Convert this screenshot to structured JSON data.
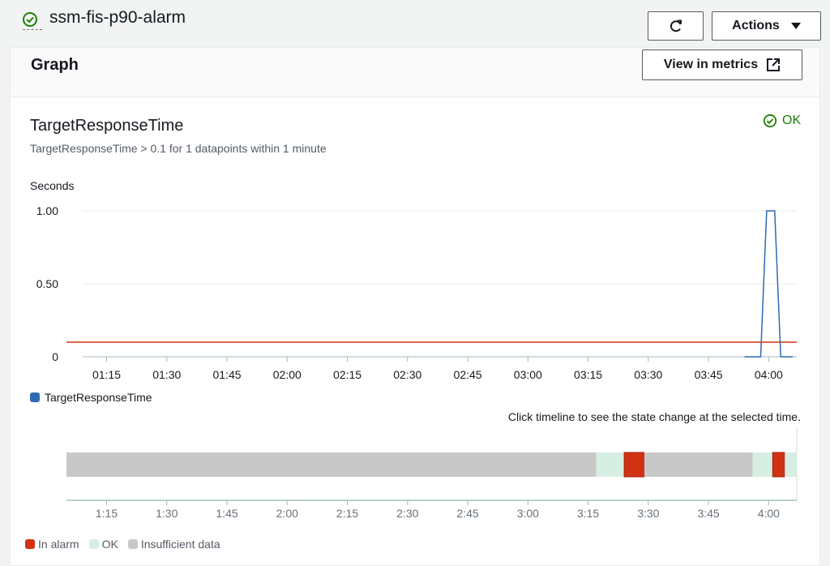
{
  "alarm": {
    "name": "ssm-fis-p90-alarm"
  },
  "toolbar": {
    "actions_label": "Actions"
  },
  "card": {
    "title": "Graph",
    "view_metrics_label": "View in metrics",
    "metric_title": "TargetResponseTime",
    "condition": "TargetResponseTime > 0.1 for 1 datapoints within 1 minute",
    "state": "OK",
    "timeline_hint": "Click timeline to see the state change at the selected time."
  },
  "icons": {
    "status": "check-circle-icon",
    "refresh": "refresh-icon",
    "actions": "caret-down-icon",
    "external": "external-link-icon",
    "ok": "check-circle-icon"
  },
  "colors": {
    "series": "#2e6bb3",
    "threshold": "#d13212",
    "ok": "#1d8102",
    "in_alarm": "#d13212",
    "ok_state": "#d7eee2",
    "insufficient": "#c8c8c8"
  },
  "chart_data": [
    {
      "type": "line",
      "ylabel": "Seconds",
      "y_ticks": [
        "1.00",
        "0.50",
        "0"
      ],
      "ylim": [
        0,
        1
      ],
      "x_ticks": [
        "01:15",
        "01:30",
        "01:45",
        "02:00",
        "02:15",
        "02:30",
        "02:45",
        "03:00",
        "03:15",
        "03:30",
        "03:45",
        "04:00"
      ],
      "xlim_minutes": [
        65,
        247
      ],
      "threshold": 0.1,
      "series": [
        {
          "name": "TargetResponseTime",
          "points": [
            [
              234,
              0
            ],
            [
              238,
              0
            ],
            [
              239.5,
              1
            ],
            [
              241.5,
              1
            ],
            [
              243,
              0
            ],
            [
              246,
              0
            ]
          ]
        }
      ],
      "grid": true,
      "legend": "bottom-left"
    },
    {
      "type": "timeline",
      "x_ticks": [
        "1:15",
        "1:30",
        "1:45",
        "2:00",
        "2:15",
        "2:30",
        "2:45",
        "3:00",
        "3:15",
        "3:30",
        "3:45",
        "4:00"
      ],
      "xlim_minutes": [
        65,
        247
      ],
      "segments": [
        {
          "state": "insufficient",
          "start": 65,
          "end": 197
        },
        {
          "state": "ok",
          "start": 197,
          "end": 204
        },
        {
          "state": "alarm",
          "start": 204,
          "end": 209
        },
        {
          "state": "insufficient",
          "start": 209,
          "end": 236
        },
        {
          "state": "ok",
          "start": 236,
          "end": 241
        },
        {
          "state": "alarm",
          "start": 241,
          "end": 244
        },
        {
          "state": "ok",
          "start": 244,
          "end": 247
        }
      ],
      "legend": [
        "In alarm",
        "OK",
        "Insufficient data"
      ]
    }
  ]
}
